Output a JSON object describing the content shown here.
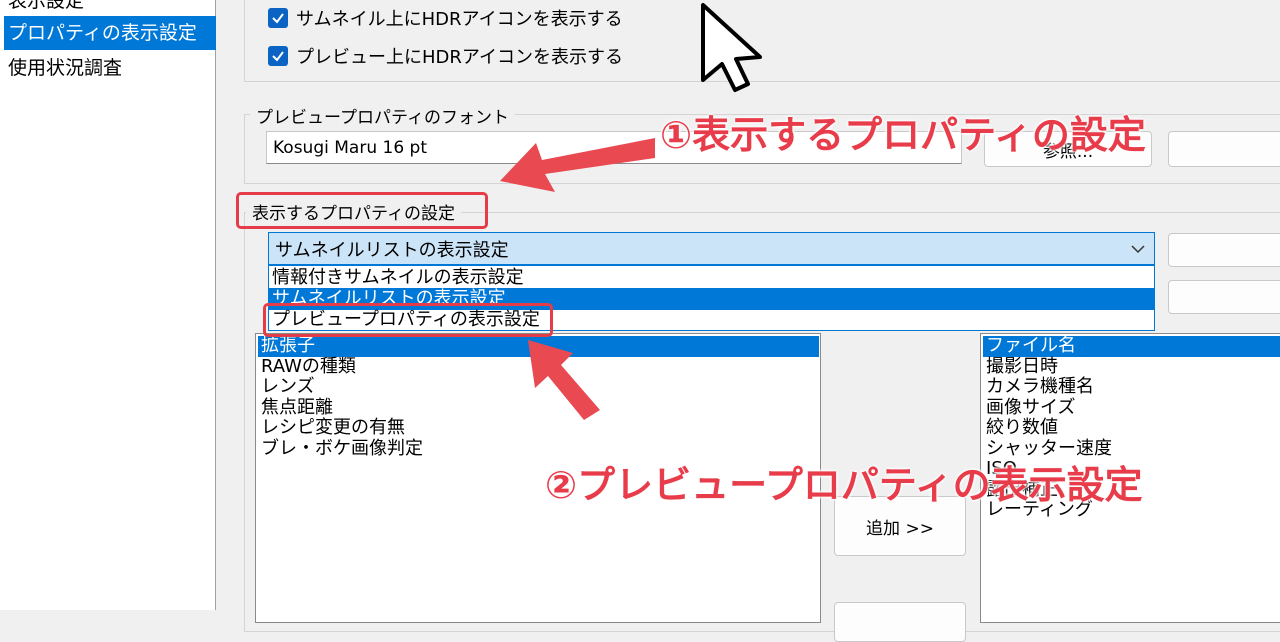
{
  "sidebar": {
    "items": [
      {
        "label": "表示設定"
      },
      {
        "label": "プロパティの表示設定"
      },
      {
        "label": "使用状況調査"
      }
    ]
  },
  "hdr_section": {
    "checkbox_thumbnail_hdr": {
      "label": "サムネイル上にHDRアイコンを表示する",
      "checked": true
    },
    "checkbox_preview_hdr": {
      "label": "プレビュー上にHDRアイコンを表示する",
      "checked": true
    }
  },
  "font_section": {
    "legend": "プレビュープロパティのフォント",
    "font_value": "Kosugi Maru 16 pt",
    "browse_button": "参照..."
  },
  "property_section": {
    "legend": "表示するプロパティの設定",
    "combo_selected": "サムネイルリストの表示設定",
    "dropdown_options": [
      {
        "label": "情報付きサムネイルの表示設定"
      },
      {
        "label": "サムネイルリストの表示設定"
      },
      {
        "label": "プレビュープロパティの表示設定"
      }
    ],
    "available_list": [
      {
        "label": "拡張子"
      },
      {
        "label": "RAWの種類"
      },
      {
        "label": "レンズ"
      },
      {
        "label": "焦点距離"
      },
      {
        "label": "レシピ変更の有無"
      },
      {
        "label": "ブレ・ボケ画像判定"
      }
    ],
    "add_button": "追加 >>",
    "selected_list": [
      {
        "label": "ファイル名"
      },
      {
        "label": "撮影日時"
      },
      {
        "label": "カメラ機種名"
      },
      {
        "label": "画像サイズ"
      },
      {
        "label": "絞り数値"
      },
      {
        "label": "シャッター速度"
      },
      {
        "label": "ISO"
      },
      {
        "label": "露出補正"
      },
      {
        "label": "レーティング"
      }
    ]
  },
  "annotations": {
    "step1": "①表示するプロパティの設定",
    "step2": "②プレビュープロパティの表示設定"
  },
  "colors": {
    "accent": "#0078d7",
    "annotation_red": "#e83c4a"
  }
}
